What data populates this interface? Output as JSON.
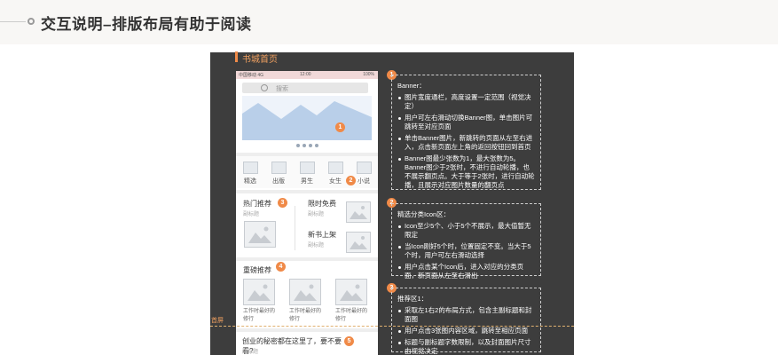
{
  "header": {
    "title": "交互说明–排版布局有助于阅读"
  },
  "board": {
    "title": "书城首页",
    "fold_label": "首屏"
  },
  "phone": {
    "status": {
      "carrier": "中国移动 4G",
      "time": "12:00",
      "battery": "100%"
    },
    "search_placeholder": "搜索",
    "categories": [
      "精选",
      "出版",
      "男生",
      "女生",
      "小说"
    ],
    "hot": {
      "title": "热门推荐",
      "sub": "副标题"
    },
    "free": {
      "title": "限时免费",
      "sub": "副标题"
    },
    "newbook": {
      "title": "新书上架",
      "sub": "副标题"
    },
    "heavy": {
      "title": "重磅推荐",
      "items": [
        "工作时最好的修行",
        "工作时最好的修行",
        "工作时最好的修行"
      ]
    },
    "bottom": {
      "title": "创业的秘密都在这里了，要不要看?",
      "sub": "副标题"
    }
  },
  "badges": [
    "1",
    "2",
    "3",
    "4",
    "5"
  ],
  "notes": [
    {
      "head": "Banner：",
      "items": [
        "图片宽度通栏，高度设置一定范围（视觉决定）",
        "用户可左右滑动切换Banner图，单击图片可跳转至对应页面",
        "单击Banner图片，新跳转的页面从左至右进入，点击新页面左上角的返回按钮回到首页",
        "Banner图最少张数为1，最大张数为5。Banner图少于2张时，不进行自动轮播，也不展示翻页点。大于等于2张时，进行自动轮播，且展示对应图片数量的翻页点"
      ]
    },
    {
      "head": "精选分类Icon区：",
      "items": [
        "Icon至少5个、小于5个不展示，最大值暂无限定",
        "当Icon刚好5个时，位置固定不变。当大于5个时，用户可左右滑动选择",
        "用户点击某个Icon后，进入对应的分类页面，新页面从左至右滑出"
      ]
    },
    {
      "head": "推荐区1：",
      "items": [
        "采取左1右2的布局方式，包含主副标题和封面图",
        "用户点击3张图内容区域，跳转至相应页面",
        "标题与副标题字数限制，以及封面图片尺寸由视觉决定"
      ]
    }
  ],
  "colors": {
    "accent": "#f08a48",
    "board": "#3d3d3d"
  }
}
